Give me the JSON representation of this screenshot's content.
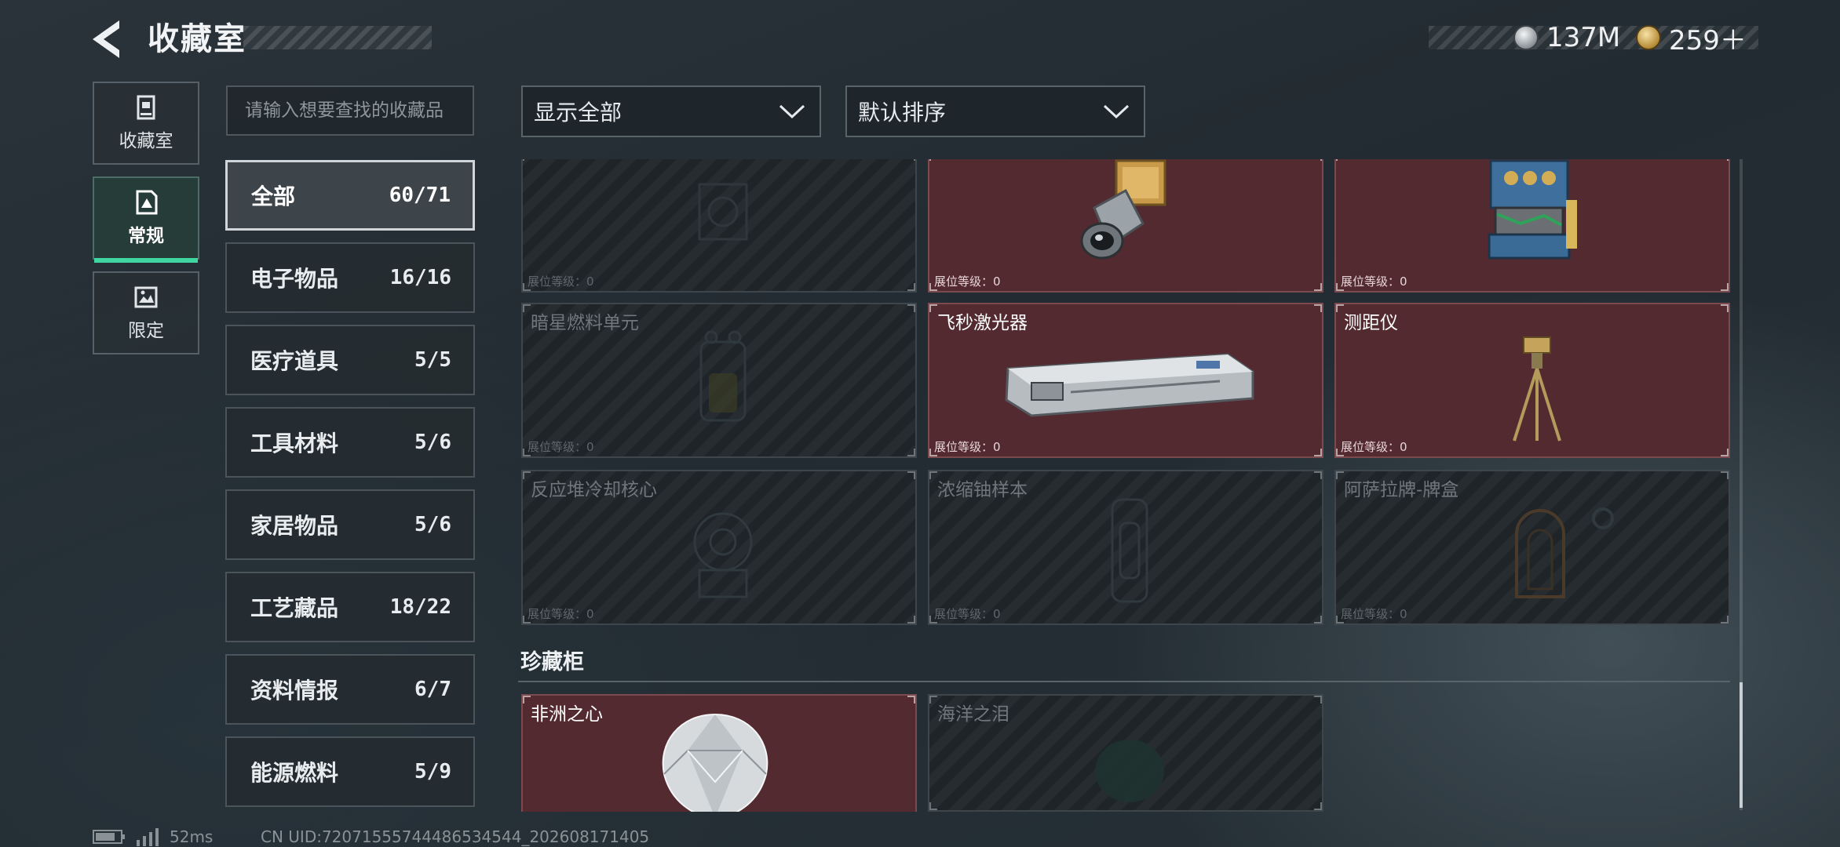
{
  "header": {
    "title": "收藏室",
    "back_icon": "back-arrow-icon",
    "currencies": [
      {
        "icon": "silver-coin-icon",
        "value": "137M"
      },
      {
        "icon": "gold-coin-icon",
        "value": "259＋"
      }
    ]
  },
  "nav": {
    "items": [
      {
        "label": "收藏室",
        "icon": "collection-room-icon",
        "active": false
      },
      {
        "label": "常规",
        "icon": "regular-icon",
        "active": true
      },
      {
        "label": "限定",
        "icon": "limited-icon",
        "active": false
      }
    ],
    "accent": "#3fd6a1"
  },
  "search": {
    "placeholder": "请输入想要查找的收藏品"
  },
  "filters": {
    "show": "显示全部",
    "sort": "默认排序"
  },
  "categories": [
    {
      "name": "全部",
      "count": "60/71",
      "active": true
    },
    {
      "name": "电子物品",
      "count": "16/16"
    },
    {
      "name": "医疗道具",
      "count": "5/5"
    },
    {
      "name": "工具材料",
      "count": "5/6"
    },
    {
      "name": "家居物品",
      "count": "5/6"
    },
    {
      "name": "工艺藏品",
      "count": "18/22"
    },
    {
      "name": "资料情报",
      "count": "6/7"
    },
    {
      "name": "能源燃料",
      "count": "5/9"
    }
  ],
  "cards": [
    {
      "name": "",
      "display_level": "展位等级：0",
      "owned": false,
      "art": "unknown-device"
    },
    {
      "name": "",
      "display_level": "展位等级：0",
      "owned": true,
      "art": "camera-lens-module"
    },
    {
      "name": "",
      "display_level": "展位等级：0",
      "owned": true,
      "art": "engine-block"
    },
    {
      "name": "暗星燃料单元",
      "display_level": "展位等级：0",
      "owned": false,
      "art": "fuel-cell"
    },
    {
      "name": "飞秒激光器",
      "display_level": "展位等级：0",
      "owned": true,
      "art": "femtosecond-laser"
    },
    {
      "name": "测距仪",
      "display_level": "展位等级：0",
      "owned": true,
      "art": "rangefinder-tripod"
    },
    {
      "name": "反应堆冷却核心",
      "display_level": "展位等级：0",
      "owned": false,
      "art": "reactor-core"
    },
    {
      "name": "浓缩铀样本",
      "display_level": "展位等级：0",
      "owned": false,
      "art": "uranium-sample"
    },
    {
      "name": "阿萨拉牌-牌盒",
      "display_level": "展位等级：0",
      "owned": false,
      "art": "card-box"
    }
  ],
  "cabinet": {
    "title": "珍藏柜",
    "cards": [
      {
        "name": "非洲之心",
        "owned": true,
        "art": "diamond"
      },
      {
        "name": "海洋之泪",
        "owned": false,
        "art": "gem-dark"
      }
    ]
  },
  "footer": {
    "ping": "52ms",
    "uid": "CN UID:720715557444865345​44_202608171405"
  },
  "colors": {
    "owned_card": "#532a2f",
    "locked_card": "#1e2428",
    "active_tab_border": "#cfd5d9"
  }
}
